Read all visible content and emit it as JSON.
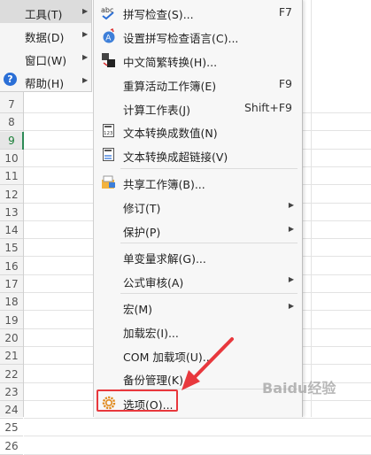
{
  "left_menu": {
    "items": [
      {
        "label": "工具(T)",
        "icon": "",
        "selected": true
      },
      {
        "label": "数据(D)",
        "icon": ""
      },
      {
        "label": "窗口(W)",
        "icon": ""
      },
      {
        "label": "帮助(H)",
        "icon": "help-icon",
        "icon_glyph": "?"
      }
    ]
  },
  "tools_menu": {
    "items": [
      {
        "label": "拼写检查(S)...",
        "shortcut": "F7",
        "icon": "spell-check-icon",
        "icon_glyph": "abc"
      },
      {
        "label": "设置拼写检查语言(C)...",
        "shortcut": "",
        "icon": "language-icon"
      },
      {
        "label": "中文简繁转换(H)...",
        "shortcut": "",
        "icon": "chinese-convert-icon"
      },
      {
        "label": "重算活动工作簿(E)",
        "shortcut": "F9",
        "icon": ""
      },
      {
        "label": "计算工作表(J)",
        "shortcut": "Shift+F9",
        "icon": ""
      },
      {
        "label": "文本转换成数值(N)",
        "shortcut": "",
        "icon": "text-to-number-icon",
        "icon_glyph": "123"
      },
      {
        "label": "文本转换成超链接(V)",
        "shortcut": "",
        "icon": "text-to-link-icon"
      },
      {
        "label": "共享工作簿(B)...",
        "shortcut": "",
        "icon": "share-workbook-icon"
      },
      {
        "label": "修订(T)",
        "shortcut": "",
        "icon": "",
        "submenu": true
      },
      {
        "label": "保护(P)",
        "shortcut": "",
        "icon": "",
        "submenu": true
      },
      {
        "label": "单变量求解(G)...",
        "shortcut": "",
        "icon": ""
      },
      {
        "label": "公式审核(A)",
        "shortcut": "",
        "icon": "",
        "submenu": true
      },
      {
        "label": "宏(M)",
        "shortcut": "",
        "icon": "",
        "submenu": true
      },
      {
        "label": "加载宏(I)...",
        "shortcut": "",
        "icon": ""
      },
      {
        "label": "COM 加载项(U)...",
        "shortcut": "",
        "icon": ""
      },
      {
        "label": "备份管理(K)",
        "shortcut": "",
        "icon": ""
      },
      {
        "label": "选项(O)...",
        "shortcut": "",
        "icon": "gear-icon"
      }
    ]
  },
  "sheet": {
    "rows": [
      "7",
      "8",
      "9",
      "10",
      "11",
      "12",
      "13",
      "14",
      "15",
      "16",
      "17",
      "18",
      "19",
      "20",
      "21",
      "22",
      "23",
      "24",
      "25",
      "26"
    ],
    "active_row": "9"
  },
  "watermark": "Baidu经验",
  "colors": {
    "highlight": "#e8383d",
    "menu_bg": "#f7f7f7",
    "active_row": "#2e8b57"
  }
}
